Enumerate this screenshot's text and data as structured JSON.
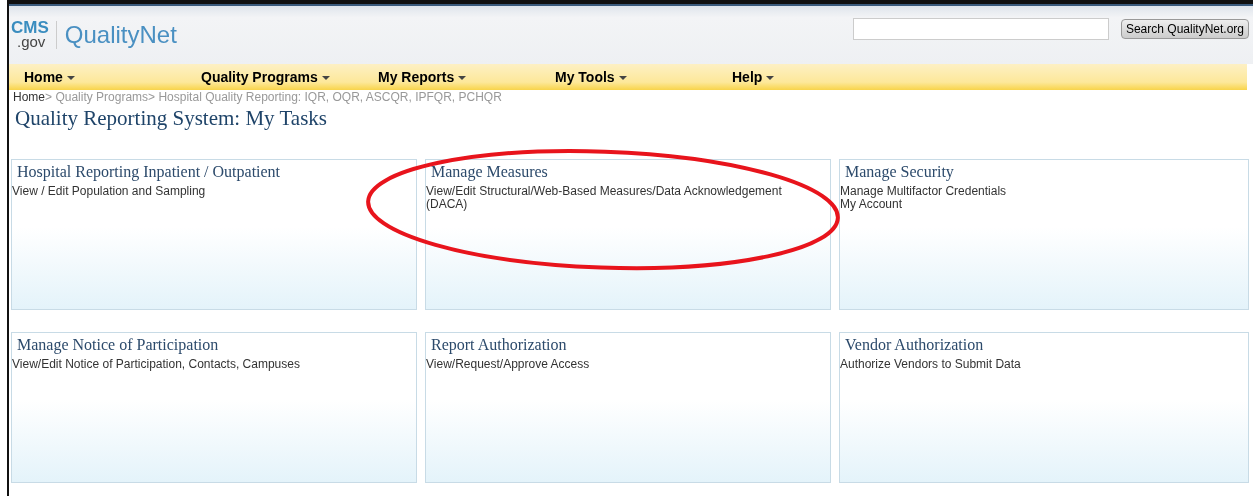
{
  "header": {
    "logo_top": "CMS",
    "logo_bottom": ".gov",
    "site_name": "QualityNet",
    "search_button": "Search QualityNet.org"
  },
  "nav": [
    "Home",
    "Quality Programs",
    "My Reports",
    "My Tools",
    "Help"
  ],
  "breadcrumb": [
    "Home",
    "Quality Programs",
    "Hospital Quality Reporting: IQR, OQR, ASCQR, IPFQR, PCHQR"
  ],
  "breadcrumb_separator": ">",
  "title": "Quality Reporting System: My Tasks",
  "tiles": [
    {
      "title": "Hospital Reporting Inpatient / Outpatient",
      "links": [
        "View / Edit Population and Sampling"
      ]
    },
    {
      "title": "Manage Measures",
      "links": [
        "View/Edit Structural/Web-Based Measures/Data Acknowledgement (DACA)"
      ]
    },
    {
      "title": "Manage Security",
      "links": [
        "Manage Multifactor Credentials",
        "My Account"
      ]
    },
    {
      "title": "Manage Notice of Participation",
      "links": [
        "View/Edit Notice of Participation, Contacts, Campuses"
      ]
    },
    {
      "title": "Report Authorization",
      "links": [
        "View/Request/Approve Access"
      ]
    },
    {
      "title": "Vendor Authorization",
      "links": [
        "Authorize Vendors to Submit Data"
      ]
    }
  ]
}
